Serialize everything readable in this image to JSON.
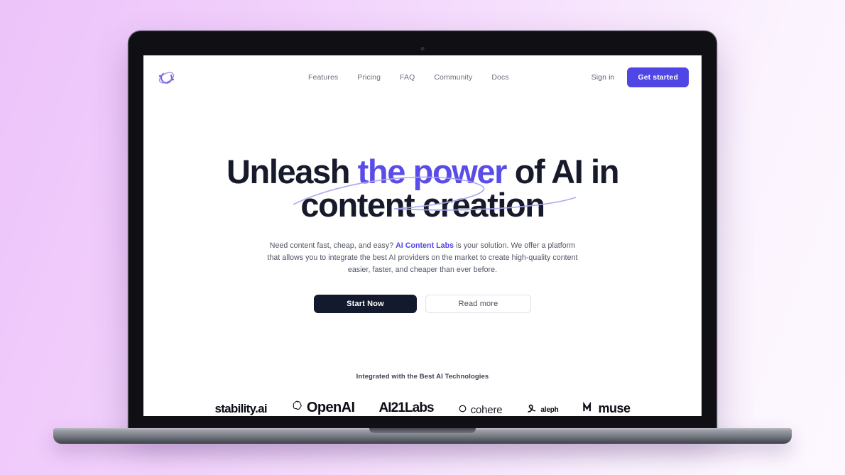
{
  "window": {
    "device": "laptop-mockup",
    "background_gradient_from": "#edc3fa",
    "background_gradient_to": "#fdf8ff"
  },
  "site": {
    "brand": {
      "name": "AI Content Labs",
      "logo_icon": "orbit-c-logo-icon",
      "logo_color": "#6c5ce7"
    },
    "nav": {
      "items": [
        {
          "label": "Features"
        },
        {
          "label": "Pricing"
        },
        {
          "label": "FAQ"
        },
        {
          "label": "Community"
        },
        {
          "label": "Docs"
        }
      ],
      "sign_in_label": "Sign in",
      "get_started_label": "Get started",
      "get_started_color": "#4f46e5"
    },
    "hero": {
      "headline_part1": "Unleash ",
      "headline_accent": "the power",
      "headline_part2": " of AI in",
      "headline_line2": "content creation",
      "headline_color": "#161a2b",
      "accent_color": "#5a4ce8",
      "sub_line1_a": "Need content fast, cheap, and easy? ",
      "sub_brand": "AI Content Labs",
      "sub_line1_b": " is your solution. We offer",
      "sub_line2": "a platform that allows you to integrate the best AI providers on the market to",
      "sub_line3": "create high-quality content easier, faster, and cheaper than ever before.",
      "primary_cta": "Start Now",
      "primary_cta_color": "#141a2e",
      "secondary_cta": "Read more"
    },
    "partners": {
      "title": "Integrated with the Best AI Technologies",
      "logos": [
        {
          "name": "stability.ai",
          "icon": "none"
        },
        {
          "name": "OpenAI",
          "icon": "openai-swirl-icon"
        },
        {
          "name": "AI21Labs",
          "icon": "none"
        },
        {
          "name": "cohere",
          "icon": "cohere-mark-icon"
        },
        {
          "name": "aleph",
          "icon": "aleph-alpha-icon"
        },
        {
          "name": "muse",
          "icon": "muse-m-icon"
        }
      ]
    }
  }
}
